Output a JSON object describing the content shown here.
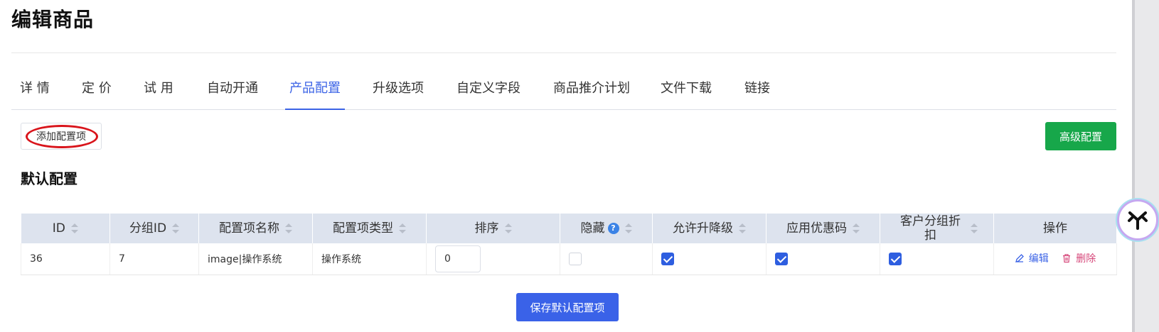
{
  "page": {
    "title": "编辑商品"
  },
  "tabs": [
    {
      "label": "详 情"
    },
    {
      "label": "定 价"
    },
    {
      "label": "试 用"
    },
    {
      "label": "自动开通"
    },
    {
      "label": "产品配置",
      "active": true
    },
    {
      "label": "升级选项"
    },
    {
      "label": "自定义字段"
    },
    {
      "label": "商品推介计划"
    },
    {
      "label": "文件下载"
    },
    {
      "label": "链接"
    }
  ],
  "toolbar": {
    "add_label": "添加配置项",
    "advanced_label": "高级配置",
    "advanced_color": "#17a74a"
  },
  "section": {
    "title": "默认配置"
  },
  "table": {
    "columns": [
      "ID",
      "分组ID",
      "配置项名称",
      "配置项类型",
      "排序",
      "隐藏",
      "允许升降级",
      "应用优惠码",
      "客户分组折扣",
      "操作"
    ],
    "hide_help_icon": "question-icon",
    "rows": [
      {
        "id": "36",
        "group_id": "7",
        "name": "image|操作系统",
        "type": "操作系统",
        "order": "0",
        "hidden": false,
        "allow_upgrade": true,
        "apply_coupon": true,
        "group_discount": true,
        "edit_label": "编辑",
        "delete_label": "删除"
      }
    ]
  },
  "footer": {
    "save_label": "保存默认配置项",
    "save_color": "#3a62e8"
  },
  "colors": {
    "accent": "#3b63e6",
    "delete": "#d6477a",
    "header_bg": "#dde3ee"
  }
}
